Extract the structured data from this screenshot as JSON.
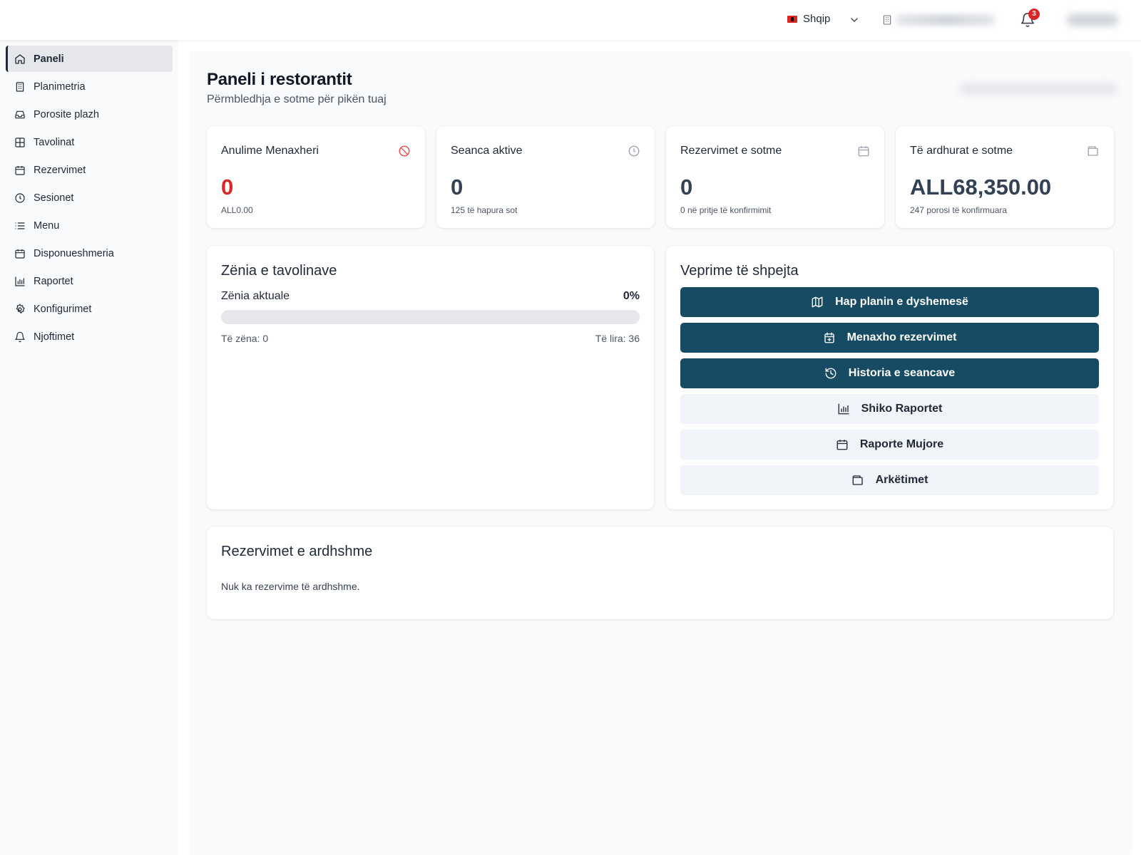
{
  "topbar": {
    "language": "Shqip",
    "notifications_count": "3"
  },
  "sidebar": {
    "items": [
      {
        "label": "Paneli",
        "icon": "home-icon",
        "active": true
      },
      {
        "label": "Planimetria",
        "icon": "building-icon"
      },
      {
        "label": "Porosite plazh",
        "icon": "inbox-icon"
      },
      {
        "label": "Tavolinat",
        "icon": "table-icon"
      },
      {
        "label": "Rezervimet",
        "icon": "calendar-icon"
      },
      {
        "label": "Sesionet",
        "icon": "clock-icon"
      },
      {
        "label": "Menu",
        "icon": "list-icon"
      },
      {
        "label": "Disponueshmeria",
        "icon": "calendar-icon"
      },
      {
        "label": "Raportet",
        "icon": "bar-chart-icon"
      },
      {
        "label": "Konfigurimet",
        "icon": "gear-icon"
      },
      {
        "label": "Njoftimet",
        "icon": "bell-icon"
      }
    ]
  },
  "header": {
    "title": "Paneli i restorantit",
    "subtitle": "Përmbledhja e sotme për pikën tuaj"
  },
  "stats": [
    {
      "title": "Anulime Menaxheri",
      "value": "0",
      "sub": "ALL0.00",
      "icon": "ban-icon",
      "color": "#dc2626"
    },
    {
      "title": "Seanca aktive",
      "value": "0",
      "sub": "125 të hapura sot",
      "icon": "clock-icon"
    },
    {
      "title": "Rezervimet e sotme",
      "value": "0",
      "sub": "0 në pritje të konfirmimit",
      "icon": "calendar-icon"
    },
    {
      "title": "Të ardhurat e sotme",
      "value": "ALL68,350.00",
      "sub": "247 porosi të konfirmuara",
      "icon": "wallet-icon"
    }
  ],
  "occupancy": {
    "title": "Zënia e tavolinave",
    "label": "Zënia aktuale",
    "percent": "0%",
    "fill_fraction": 0,
    "occupied": "Të zëna: 0",
    "free": "Të lira: 36"
  },
  "quick_actions": {
    "title": "Veprime të shpejta",
    "buttons": [
      {
        "label": "Hap planin e dyshemesë",
        "icon": "map-icon",
        "style": "primary"
      },
      {
        "label": "Menaxho rezervimet",
        "icon": "calendar-plus-icon",
        "style": "primary"
      },
      {
        "label": "Historia e seancave",
        "icon": "history-icon",
        "style": "primary"
      },
      {
        "label": "Shiko Raportet",
        "icon": "bar-chart-icon",
        "style": "secondary"
      },
      {
        "label": "Raporte Mujore",
        "icon": "calendar-icon",
        "style": "secondary"
      },
      {
        "label": "Arkëtimet",
        "icon": "wallet-icon",
        "style": "secondary"
      }
    ]
  },
  "upcoming": {
    "title": "Rezervimet e ardhshme",
    "empty": "Nuk ka rezervime të ardhshme."
  },
  "colors": {
    "primary": "#164b63",
    "danger": "#dc2626",
    "secondary_bg": "#f1f5f9"
  }
}
